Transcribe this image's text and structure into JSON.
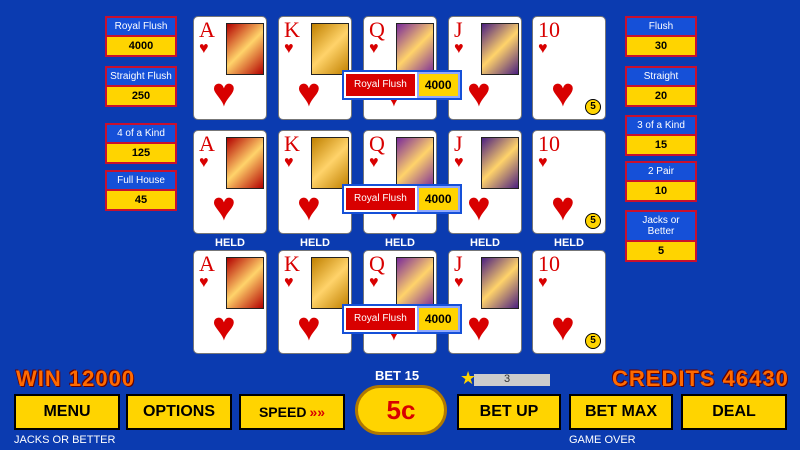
{
  "paytable_left": [
    {
      "name": "Royal Flush",
      "value": "4000"
    },
    {
      "name": "Straight Flush",
      "value": "250"
    },
    {
      "name": "4 of a Kind",
      "value": "125"
    },
    {
      "name": "Full House",
      "value": "45"
    }
  ],
  "paytable_right": [
    {
      "name": "Flush",
      "value": "30"
    },
    {
      "name": "Straight",
      "value": "20"
    },
    {
      "name": "3 of a Kind",
      "value": "15"
    },
    {
      "name": "2 Pair",
      "value": "10"
    },
    {
      "name": "Jacks or Better",
      "value": "5"
    }
  ],
  "cards": [
    "A",
    "K",
    "Q",
    "J",
    "10"
  ],
  "multiplier_badge": "5",
  "win_banner": {
    "name": "Royal Flush",
    "value": "4000"
  },
  "held_label": "HELD",
  "win_text": "WIN 12000",
  "credits_text": "CREDITS 46430",
  "bet_text": "BET 15",
  "star_count": "3",
  "game_name": "JACKS OR BETTER",
  "status": "GAME OVER",
  "buttons": {
    "menu": "MENU",
    "options": "OPTIONS",
    "speed": "SPEED",
    "denom": "5c",
    "bet_up": "BET UP",
    "bet_max": "BET MAX",
    "deal": "DEAL"
  },
  "colors": {
    "background": "#0b3bb0",
    "accent": "#ffd400",
    "heart": "#d80000"
  }
}
